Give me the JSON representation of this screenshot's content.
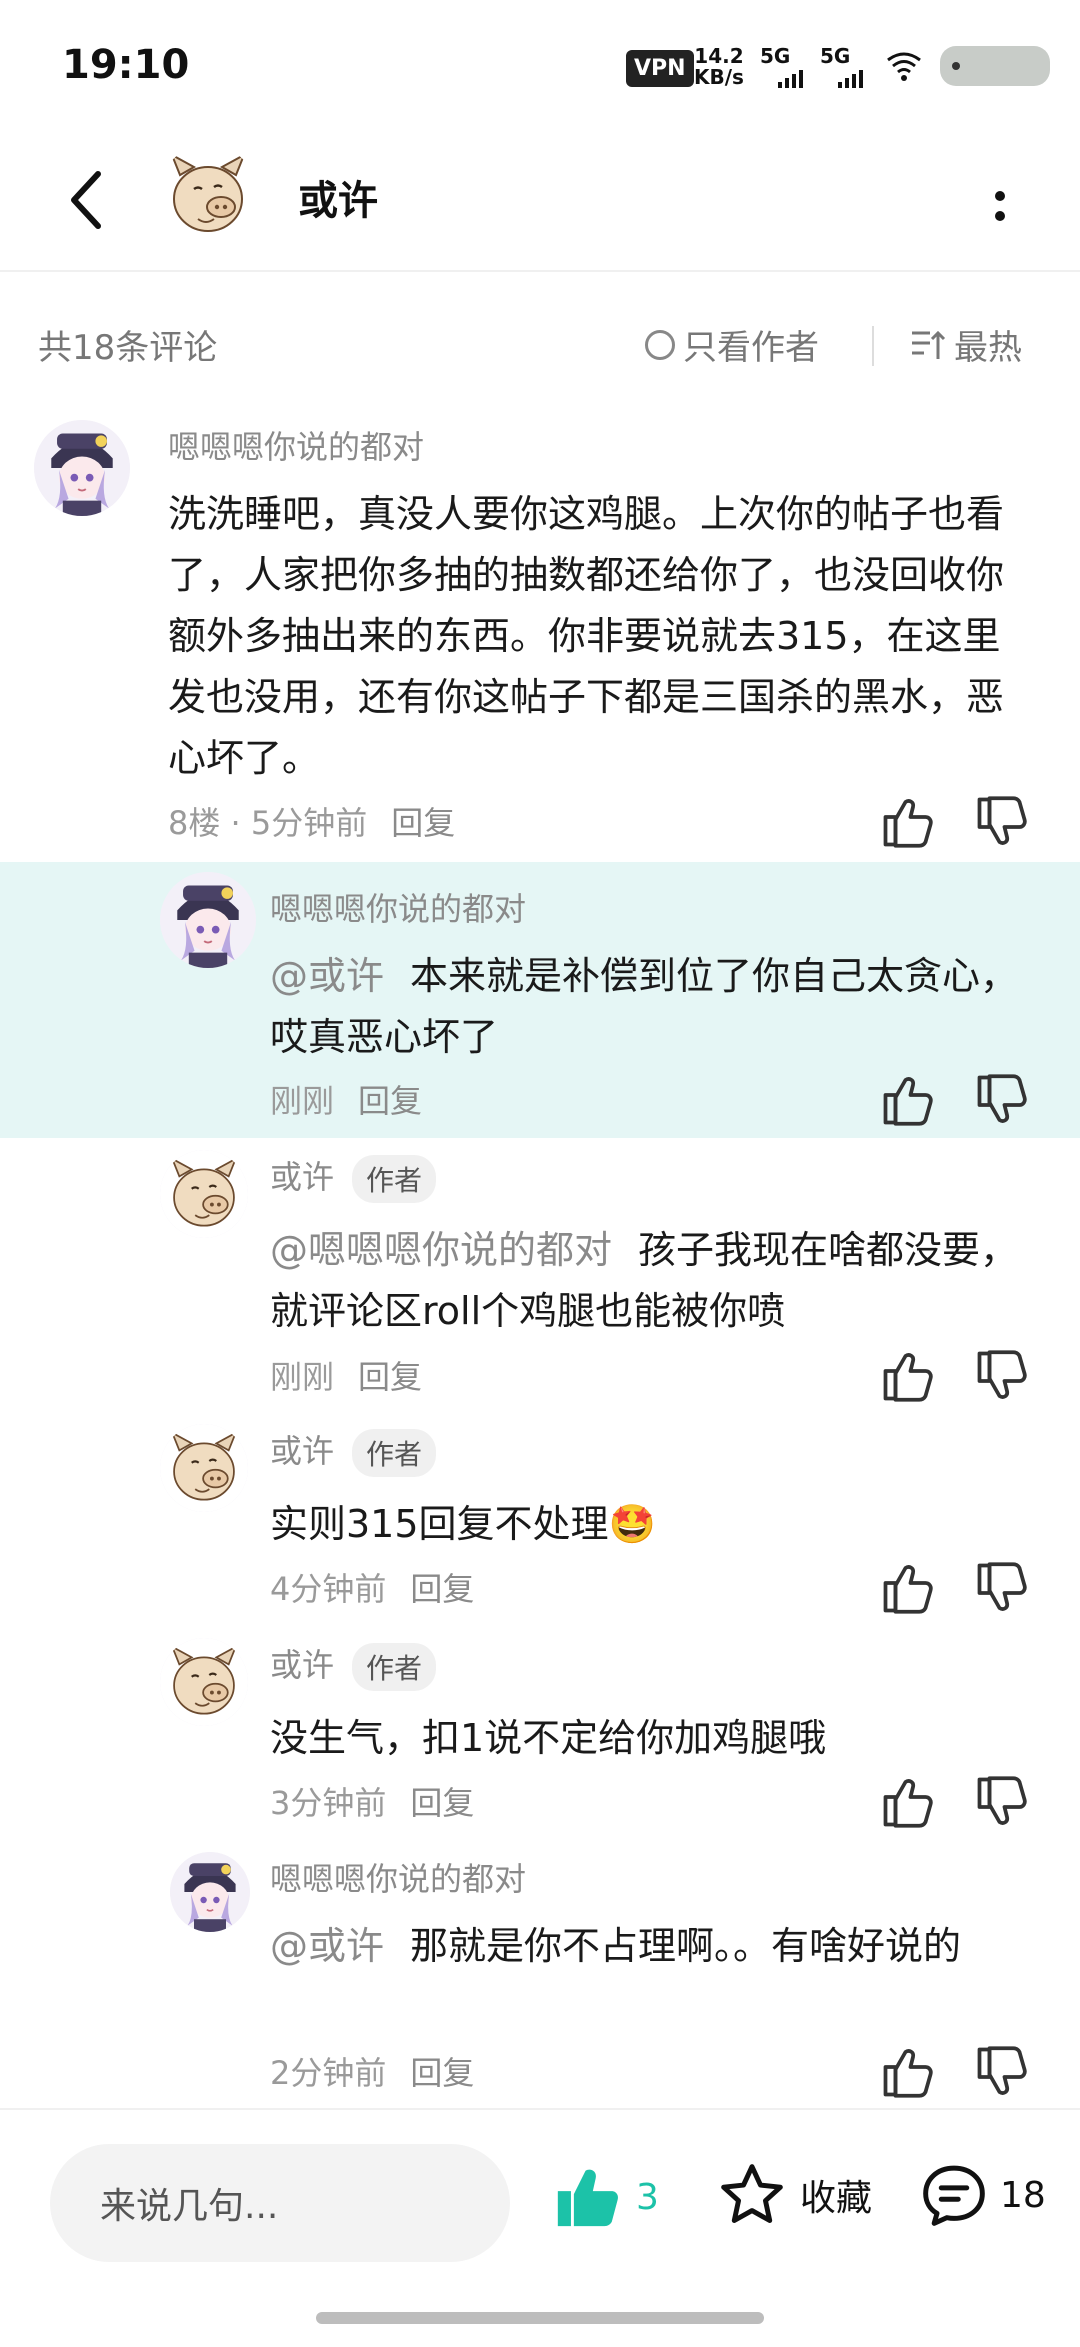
{
  "status_bar": {
    "time": "19:10",
    "vpn": "VPN",
    "speed_value": "14.2",
    "speed_unit": "KB/s",
    "net1": "5G",
    "net2": "5G"
  },
  "header": {
    "title": "或许"
  },
  "filter": {
    "count_label": "共18条评论",
    "only_author": "只看作者",
    "sort": "最热"
  },
  "comments": [
    {
      "name": "嗯嗯嗯你说的都对",
      "text": "洗洗睡吧，真没人要你这鸡腿。上次你的帖子也看了，人家把你多抽的抽数都还给你了，也没回收你额外多抽出来的东西。你非要说就去315，在这里发也没用，还有你这帖子下都是三国杀的黑水，恶心坏了。",
      "meta": "8楼 · 5分钟前",
      "reply": "回复"
    },
    {
      "name": "嗯嗯嗯你说的都对",
      "mention": "@或许",
      "text": "本来就是补偿到位了你自己太贪心，哎真恶心坏了",
      "meta": "刚刚",
      "reply": "回复"
    },
    {
      "name": "或许",
      "tag": "作者",
      "mention": "@嗯嗯嗯你说的都对",
      "text": "孩子我现在啥都没要，就评论区roll个鸡腿也能被你喷",
      "meta": "刚刚",
      "reply": "回复"
    },
    {
      "name": "或许",
      "tag": "作者",
      "text": "实则315回复不处理🤩",
      "meta": "4分钟前",
      "reply": "回复"
    },
    {
      "name": "或许",
      "tag": "作者",
      "text": "没生气，扣1说不定给你加鸡腿哦",
      "meta": "3分钟前",
      "reply": "回复"
    },
    {
      "name": "嗯嗯嗯你说的都对",
      "mention": "@或许",
      "text": "那就是你不占理啊。。有啥好说的",
      "meta": "2分钟前",
      "reply": "回复"
    }
  ],
  "bottom_bar": {
    "input_placeholder": "来说几句...",
    "like_count": "3",
    "favorite_label": "收藏",
    "comment_count": "18"
  },
  "colors": {
    "accent": "#1cc2a8",
    "highlight_bg": "#e5f6f5"
  }
}
